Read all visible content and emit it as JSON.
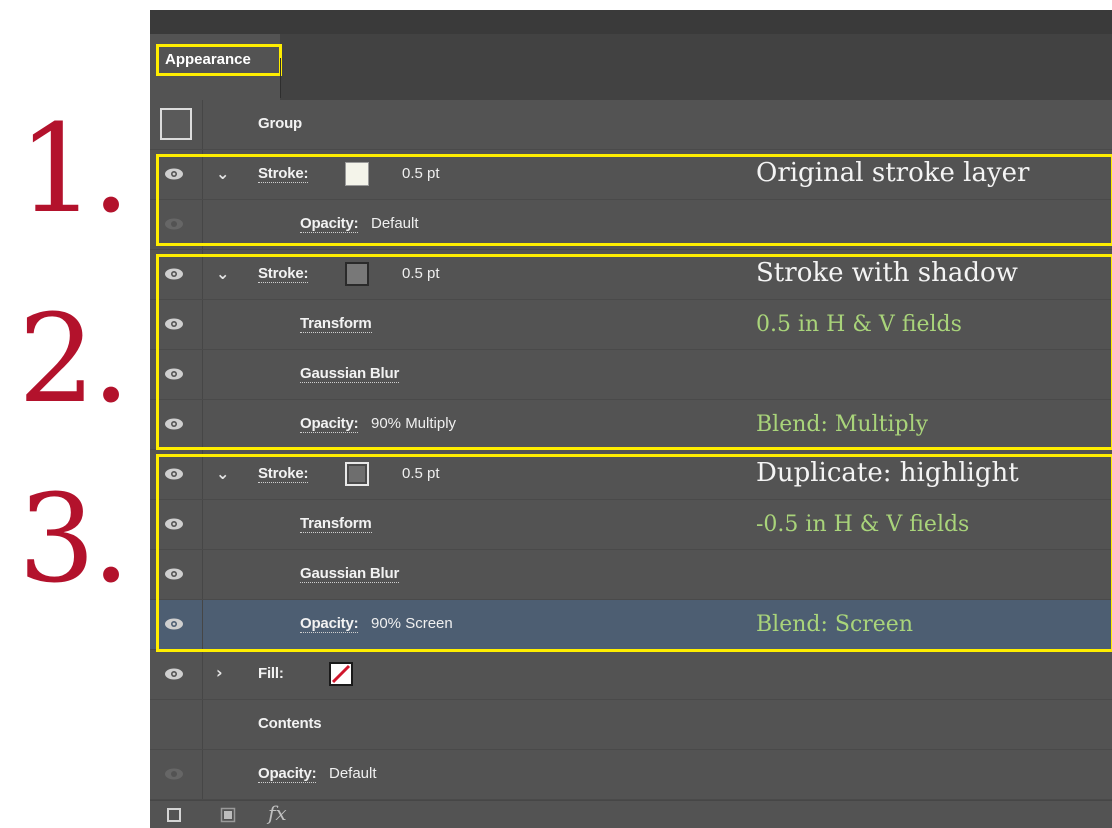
{
  "step_numbers": [
    "1.",
    "2.",
    "3."
  ],
  "panel": {
    "tab_label": "Appearance"
  },
  "rows": [
    {
      "label": "Group"
    },
    {
      "label": "Stroke:",
      "value": "0.5 pt",
      "note": "Original stroke layer"
    },
    {
      "label": "Opacity:",
      "value": "Default"
    },
    {
      "label": "Stroke:",
      "value": "0.5 pt",
      "note": "Stroke with shadow"
    },
    {
      "label": "Transform",
      "note": "0.5 in H & V fields"
    },
    {
      "label": "Gaussian Blur"
    },
    {
      "label": "Opacity:",
      "value": "90% Multiply",
      "note": "Blend: Multiply"
    },
    {
      "label": "Stroke:",
      "value": "0.5 pt",
      "note": "Duplicate: highlight"
    },
    {
      "label": "Transform",
      "note": "-0.5 in H & V fields"
    },
    {
      "label": "Gaussian Blur"
    },
    {
      "label": "Opacity:",
      "value": "90% Screen",
      "note": "Blend: Screen",
      "selected": true
    },
    {
      "label": "Fill:"
    },
    {
      "label": "Contents"
    },
    {
      "label": "Opacity:",
      "value": "Default"
    }
  ],
  "footer": {
    "fx_label": "fx"
  },
  "colors": {
    "step_number": "#b3122c",
    "highlight_border": "#ffee00",
    "note_green": "#a9d47a",
    "panel_bg": "#535353",
    "selected_row": "#4d5e72"
  },
  "icons": [
    "eye-icon",
    "chevron-down-icon",
    "chevron-right-icon",
    "new-stroke-icon",
    "new-fill-icon",
    "fx-icon",
    "no-fill-icon"
  ]
}
